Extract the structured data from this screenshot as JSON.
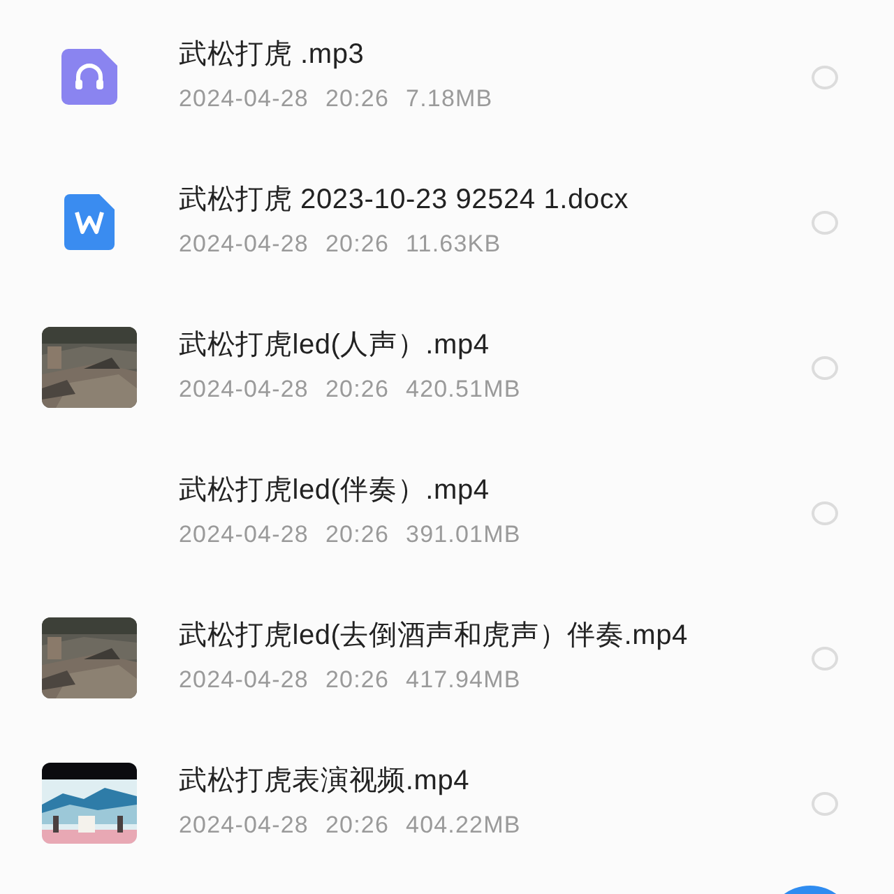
{
  "files": [
    {
      "icon": {
        "kind": "audio"
      },
      "name": "武松打虎 .mp3",
      "date": "2024-04-28",
      "time": "20:26",
      "size": "7.18MB",
      "selected": false
    },
    {
      "icon": {
        "kind": "document"
      },
      "name": "武松打虎 2023-10-23 92524 1.docx",
      "date": "2024-04-28",
      "time": "20:26",
      "size": "11.63KB",
      "selected": false
    },
    {
      "name": "武松打虎led(人声）.mp4",
      "date": "2024-04-28",
      "time": "20:26",
      "size": "420.51MB",
      "selected": false
    },
    {
      "icon": {
        "kind": "none"
      },
      "name": "武松打虎led(伴奏）.mp4",
      "date": "2024-04-28",
      "time": "20:26",
      "size": "391.01MB",
      "selected": false
    },
    {
      "name": "武松打虎led(去倒酒声和虎声）伴奏.mp4",
      "date": "2024-04-28",
      "time": "20:26",
      "size": "417.94MB",
      "selected": false
    },
    {
      "name": "武松打虎表演视频.mp4",
      "date": "2024-04-28",
      "time": "20:26",
      "size": "404.22MB",
      "selected": false
    }
  ]
}
